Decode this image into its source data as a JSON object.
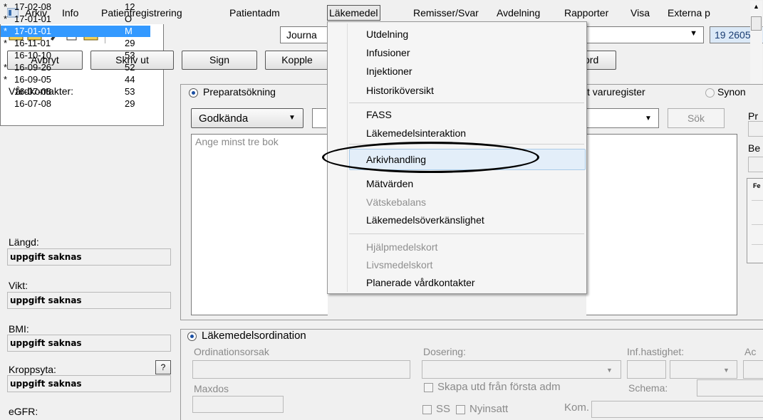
{
  "menubar": {
    "items": [
      "Arkiv",
      "Info",
      "Patientregistrering",
      "Patientadm",
      "Läkemedel",
      "Remisser/Svar",
      "Avdelning",
      "Rapporter",
      "Visa",
      "Externa p"
    ],
    "active": "Läkemedel"
  },
  "toolbar": {
    "view_combo": "Journa",
    "patient_combo": "19 2605"
  },
  "buttons": {
    "cancel": "Avbryt",
    "print": "Skriv ut",
    "sign": "Sign",
    "link": "Kopple",
    "ord": "ord"
  },
  "left": {
    "visits_label": "Vårdkontakter:",
    "visits": [
      {
        "star": "*",
        "date": "17-02-08",
        "code": "12",
        "selected": false
      },
      {
        "star": "*",
        "date": "17-01-01",
        "code": "O",
        "selected": false
      },
      {
        "star": "*",
        "date": "17-01-01",
        "code": "M",
        "selected": true
      },
      {
        "star": "*",
        "date": "16-11-01",
        "code": "29",
        "selected": false
      },
      {
        "star": "",
        "date": "16-10-10",
        "code": "53",
        "selected": false
      },
      {
        "star": "*",
        "date": "16-09-26",
        "code": "52",
        "selected": false
      },
      {
        "star": "*",
        "date": "16-09-05",
        "code": "44",
        "selected": false
      },
      {
        "star": "",
        "date": "16-07-08",
        "code": "53",
        "selected": false
      },
      {
        "star": "",
        "date": "16-07-08",
        "code": "29",
        "selected": false
      }
    ],
    "height_label": "Längd:",
    "height_value": "uppgift saknas",
    "weight_label": "Vikt:",
    "weight_value": "uppgift saknas",
    "bmi_label": "BMI:",
    "bmi_value": "uppgift saknas",
    "bsa_label": "Kroppsyta:",
    "bsa_help": "?",
    "bsa_value": "uppgift saknas",
    "egfr_label": "eGFR:"
  },
  "search": {
    "preparat_radio": "Preparatsökning",
    "varuregister_radio": "t varuregister",
    "synonym_radio": "Synon",
    "filter_value": "Godkända",
    "search_button": "Sök",
    "hint": "Ange minst tre bok",
    "right_label_1": "Pr",
    "right_label_2": "Be",
    "right_col": "Fe"
  },
  "ordination": {
    "title": "Läkemedelsordination",
    "reason_label": "Ordinationsorsak",
    "dosing_label": "Dosering:",
    "rate_label": "Inf.hastighet:",
    "ac_label": "Ac",
    "maxdos_label": "Maxdos",
    "create_label": "Skapa utd från första adm",
    "schema_label": "Schema:",
    "ss_label": "SS",
    "new_label": "Nyinsatt",
    "kom_label": "Kom."
  },
  "dropdown": {
    "items": [
      {
        "label": "Utdelning",
        "disabled": false
      },
      {
        "label": "Infusioner",
        "disabled": false
      },
      {
        "label": "Injektioner",
        "disabled": false
      },
      {
        "label": "Historiköversikt",
        "disabled": false
      },
      {
        "label": "FASS",
        "disabled": false
      },
      {
        "label": "Läkemedelsinteraktion",
        "disabled": false
      },
      {
        "label": "Arkivhandling",
        "disabled": false
      },
      {
        "label": "Mätvärden",
        "disabled": false
      },
      {
        "label": "Vätskebalans",
        "disabled": true
      },
      {
        "label": "Läkemedelsöverkänslighet",
        "disabled": false
      },
      {
        "label": "Hjälpmedelskort",
        "disabled": true
      },
      {
        "label": "Livsmedelskort",
        "disabled": true
      },
      {
        "label": "Planerade vårdkontakter",
        "disabled": false
      }
    ],
    "highlighted": "Arkivhandling"
  }
}
